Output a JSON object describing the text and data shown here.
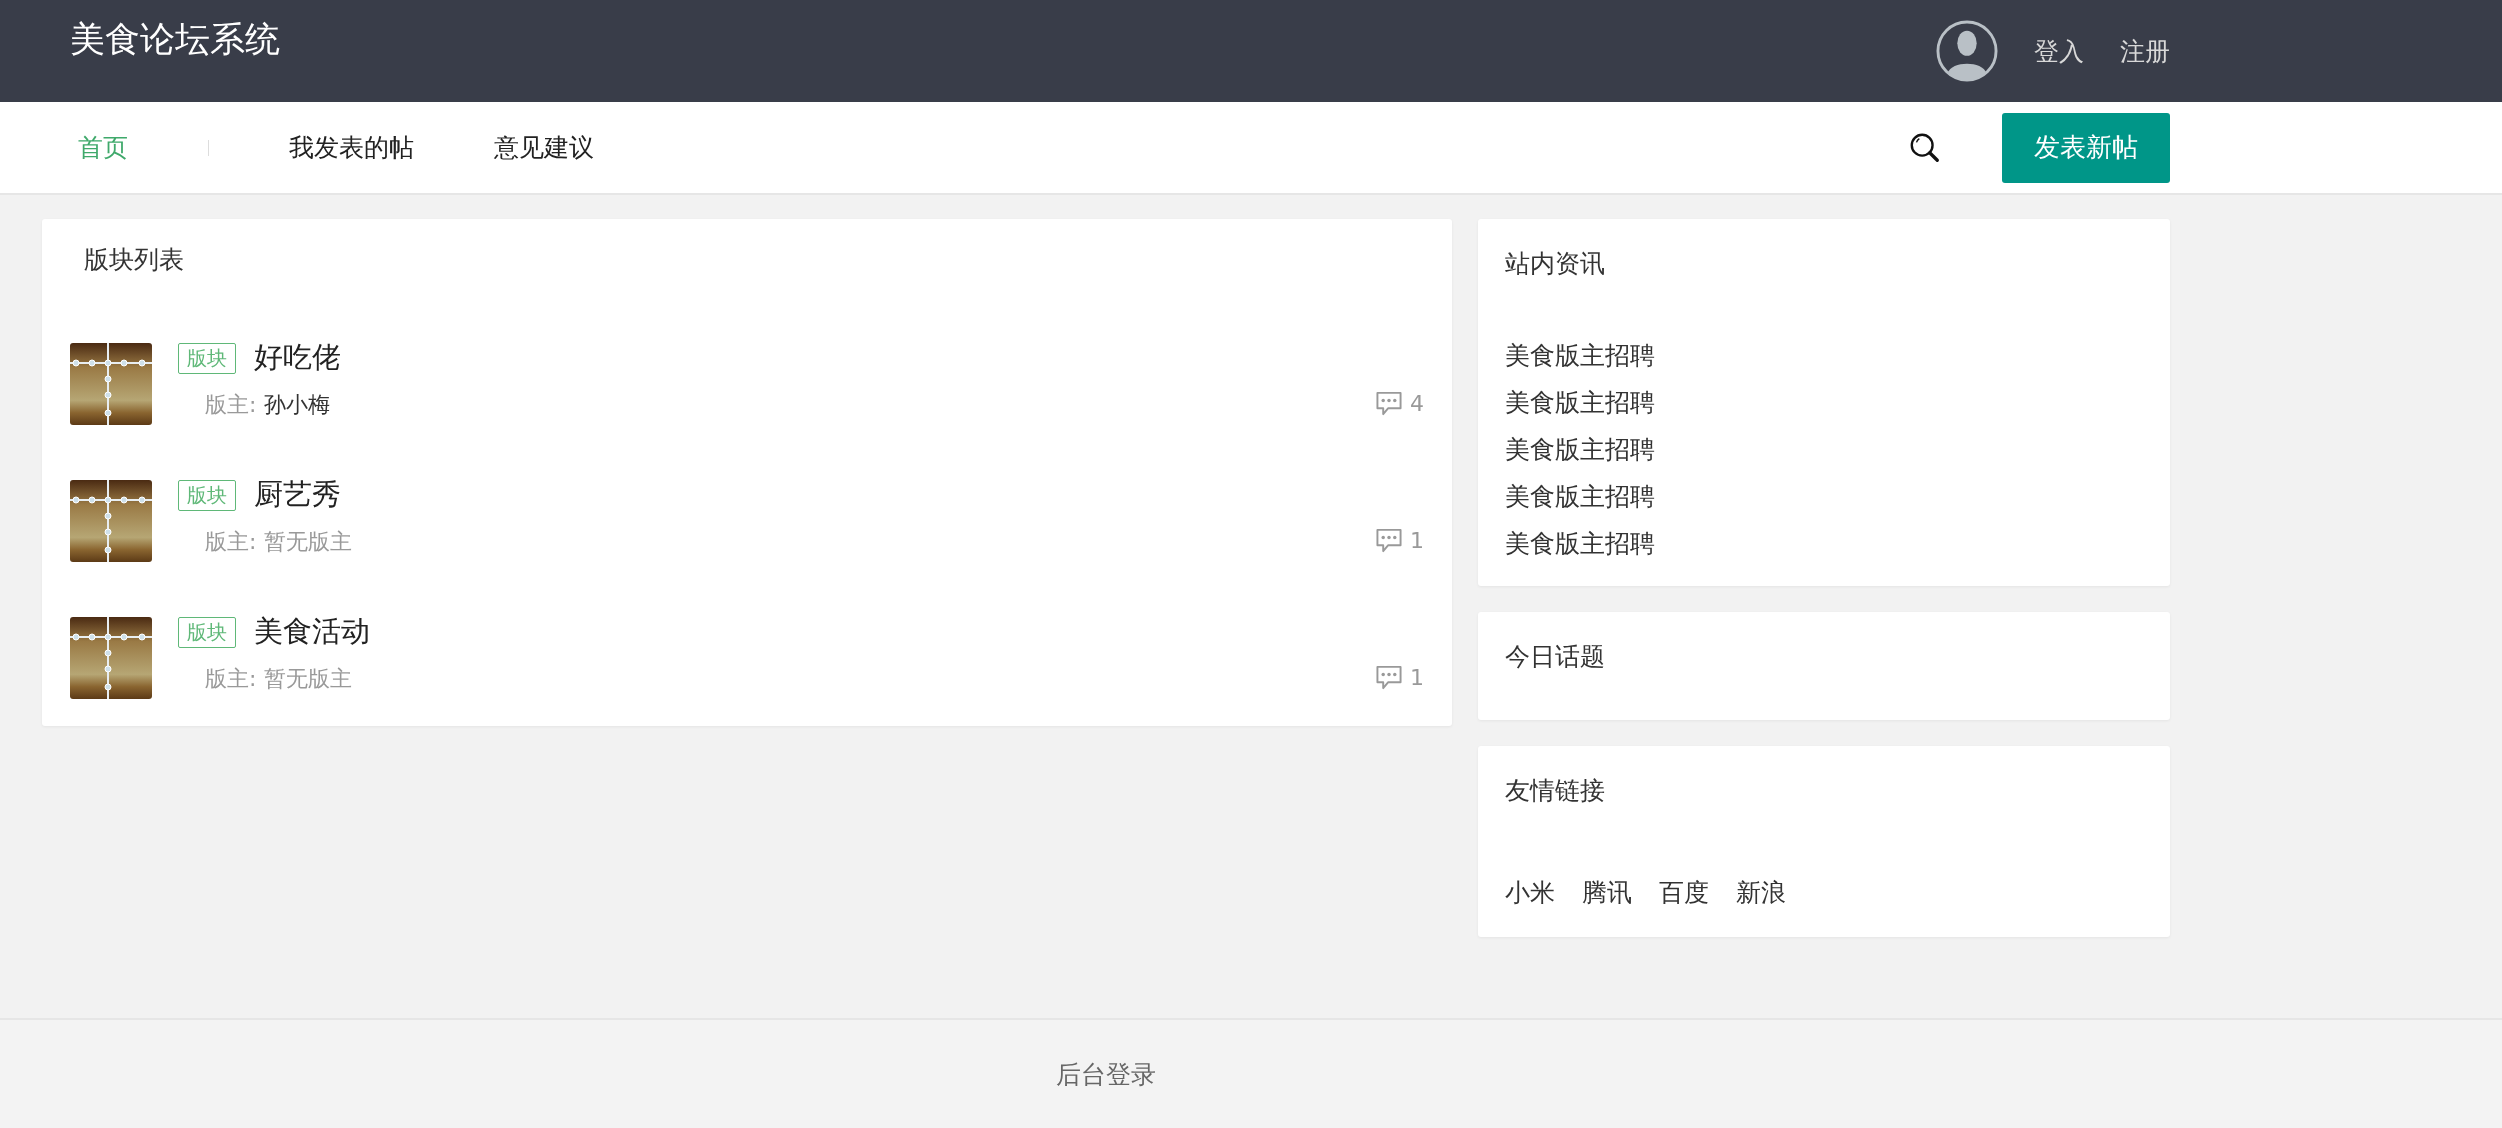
{
  "header": {
    "title": "美食论坛系统",
    "links": [
      "登入",
      "注册"
    ]
  },
  "nav": {
    "items": [
      {
        "label": "首页",
        "selected": true
      },
      {
        "label": "我发表的帖",
        "selected": false
      },
      {
        "label": "意见建议",
        "selected": false
      }
    ],
    "post_button": "发表新帖"
  },
  "board_list": {
    "title": "版块列表",
    "rows": [
      {
        "tag": "版块",
        "name": "好吃佬",
        "moderator_label": "版主:",
        "moderator": "孙小梅",
        "has_moderator": true,
        "comments": "4"
      },
      {
        "tag": "版块",
        "name": "厨艺秀",
        "moderator_label": "版主:",
        "moderator": "暂无版主",
        "has_moderator": false,
        "comments": "1"
      },
      {
        "tag": "版块",
        "name": "美食活动",
        "moderator_label": "版主:",
        "moderator": "暂无版主",
        "has_moderator": false,
        "comments": "1"
      }
    ]
  },
  "sidebar": [
    {
      "title": "站内资讯",
      "kind": "list",
      "items": [
        "美食版主招聘",
        "美食版主招聘",
        "美食版主招聘",
        "美食版主招聘",
        "美食版主招聘"
      ]
    },
    {
      "title": "今日话题"
    },
    {
      "title": "友情链接",
      "kind": "links",
      "items": [
        "小米",
        "腾讯",
        "百度",
        "新浪"
      ]
    }
  ],
  "footer": {
    "link": "后台登录"
  }
}
